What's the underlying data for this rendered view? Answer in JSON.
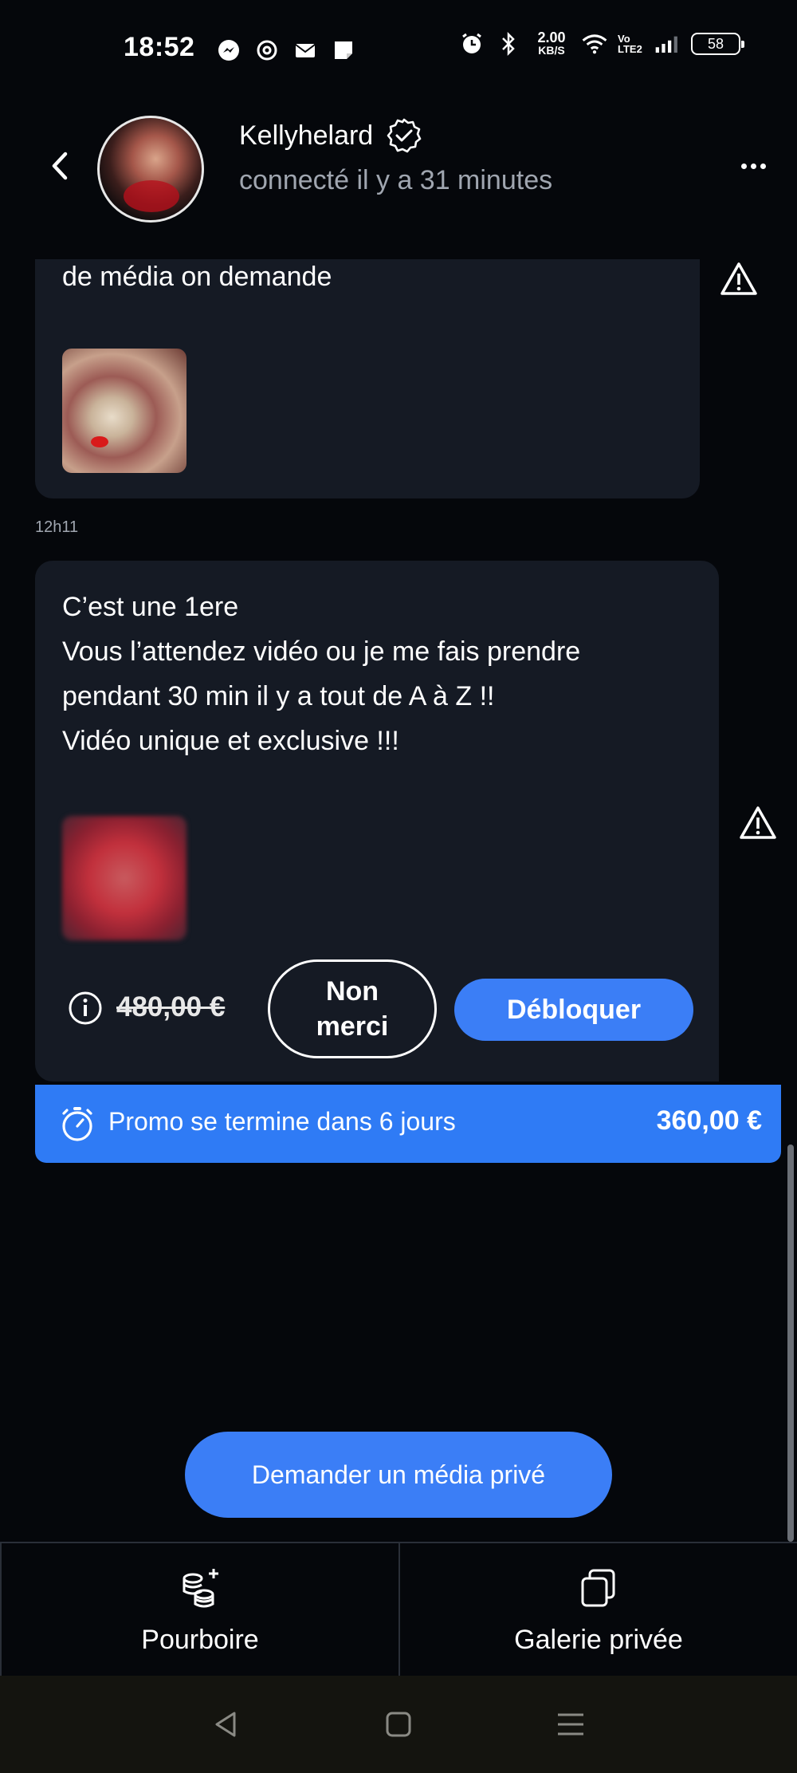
{
  "status_bar": {
    "time": "18:52",
    "net_speed": "2.00",
    "net_unit": "KB/S",
    "volte": "Vo LTE2",
    "battery": "58"
  },
  "header": {
    "username": "Kellyhelard",
    "last_seen": "connecté il y a 31 minutes"
  },
  "messages": [
    {
      "text": "de média on demande",
      "time": "12h11"
    },
    {
      "lines": [
        "C’est une 1ere",
        "Vous l’attendez vidéo ou je me fais prendre",
        "pendant 30 min il y a tout de A à Z !!",
        "Vidéo unique et exclusive !!!"
      ],
      "old_price": "480,00 €",
      "decline_label": "Non merci",
      "unlock_label": "Débloquer"
    }
  ],
  "promo": {
    "text": "Promo se termine dans 6 jours",
    "price": "360,00 €"
  },
  "request_button": "Demander un média privé",
  "tabs": [
    {
      "label": "Pourboire",
      "icon": "coins-plus-icon"
    },
    {
      "label": "Galerie privée",
      "icon": "copy-gallery-icon"
    }
  ],
  "colors": {
    "background": "#05070b",
    "bubble": "#151a24",
    "accent": "#3b7ef6"
  }
}
